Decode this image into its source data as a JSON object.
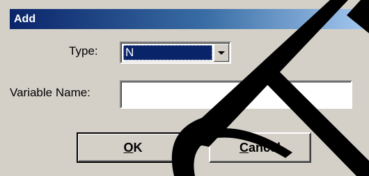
{
  "window": {
    "title": "Add"
  },
  "form": {
    "type_label": "Type:",
    "type_value": "N",
    "variable_name_label": "Variable Name:",
    "variable_name_value": ""
  },
  "buttons": {
    "ok_mnemonic": "O",
    "ok_rest": "K",
    "cancel_mnemonic": "C",
    "cancel_rest": "ancel"
  },
  "colors": {
    "title_bar": "#0a246a",
    "dialog_face": "#d4d0c8",
    "selection": "#0a246a",
    "overlay_shape": "#000000"
  }
}
